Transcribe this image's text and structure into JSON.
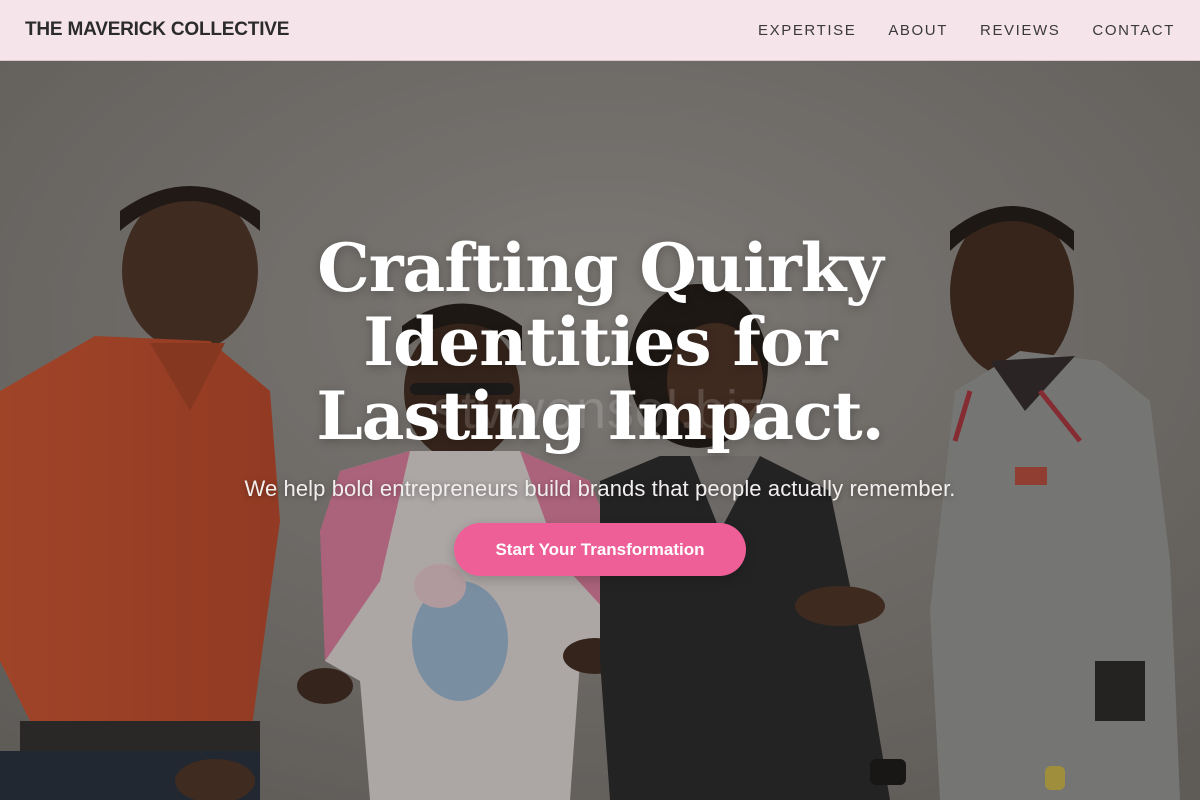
{
  "header": {
    "brand": "THE MAVERICK COLLECTIVE",
    "nav": [
      {
        "label": "EXPERTISE"
      },
      {
        "label": "ABOUT"
      },
      {
        "label": "REVIEWS"
      },
      {
        "label": "CONTACT"
      }
    ]
  },
  "hero": {
    "headline": "Crafting Quirky Identities for Lasting Impact.",
    "subhead": "We help bold entrepreneurs build brands that people actually remember.",
    "cta_label": "Start Your Transformation",
    "watermark": "stvwonsol.biz",
    "image_alt": "Four smiling young people standing together and chatting in front of a gray wall"
  },
  "colors": {
    "header_bg": "#f5e4ea",
    "accent": "#ee5f97",
    "text_dark": "#2b2b2b"
  }
}
